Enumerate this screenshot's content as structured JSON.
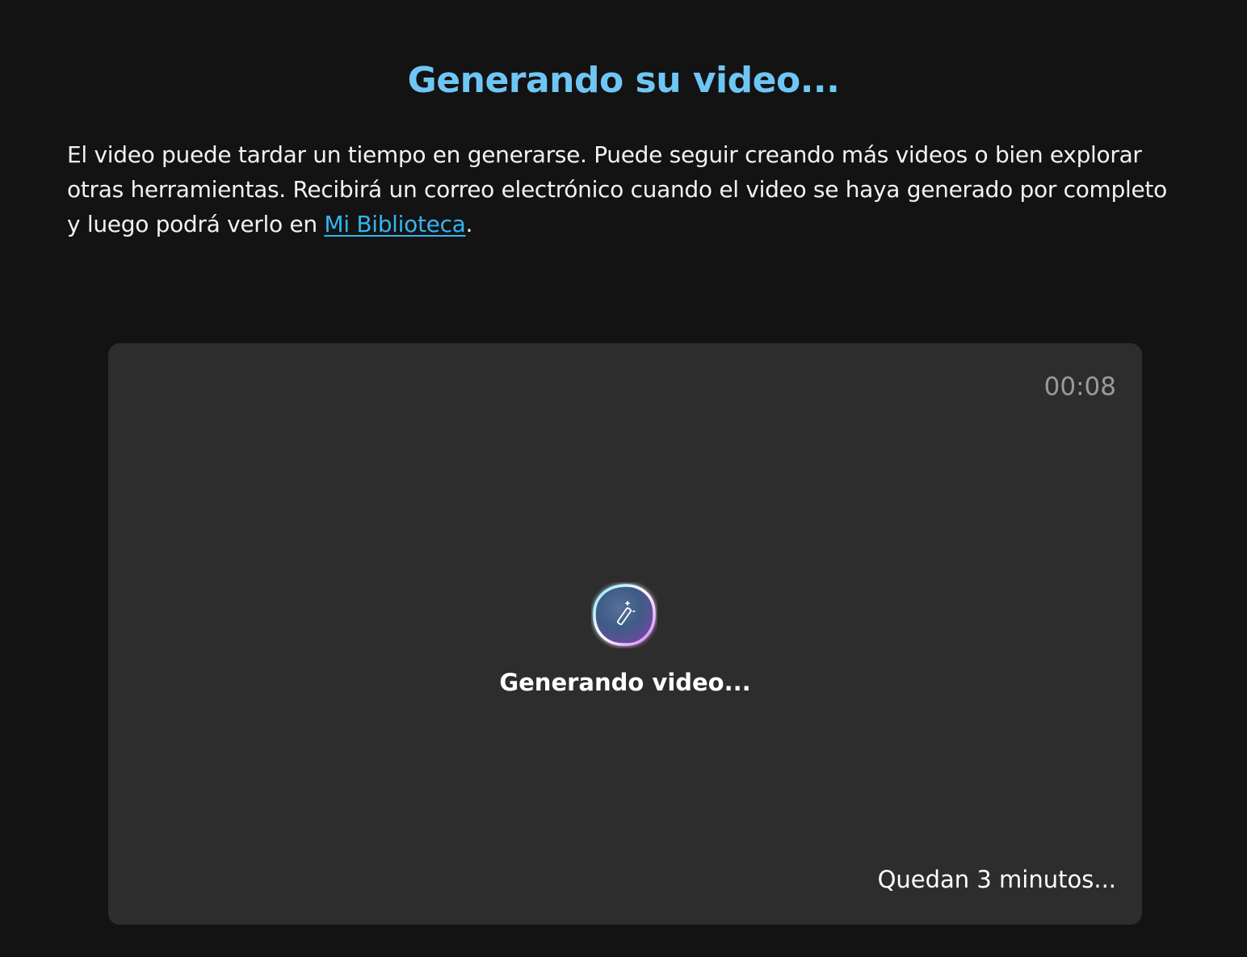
{
  "header": {
    "title": "Generando su video..."
  },
  "description": {
    "text": "El video puede tardar un tiempo en generarse. Puede seguir creando más videos o bien explorar otras herramientas. Recibirá un correo electrónico cuando el video se haya generado por completo y luego podrá verlo en ",
    "link_label": "Mi Biblioteca",
    "suffix": "."
  },
  "video_card": {
    "elapsed_time": "00:08",
    "status": "Generando video...",
    "remaining": "Quedan 3 minutos...",
    "icon": "magic-wand-icon"
  },
  "colors": {
    "background": "#131313",
    "card": "#2d2d2d",
    "title": "#6ec6f5",
    "link": "#35b5f0",
    "timer": "#9a9a9a"
  }
}
